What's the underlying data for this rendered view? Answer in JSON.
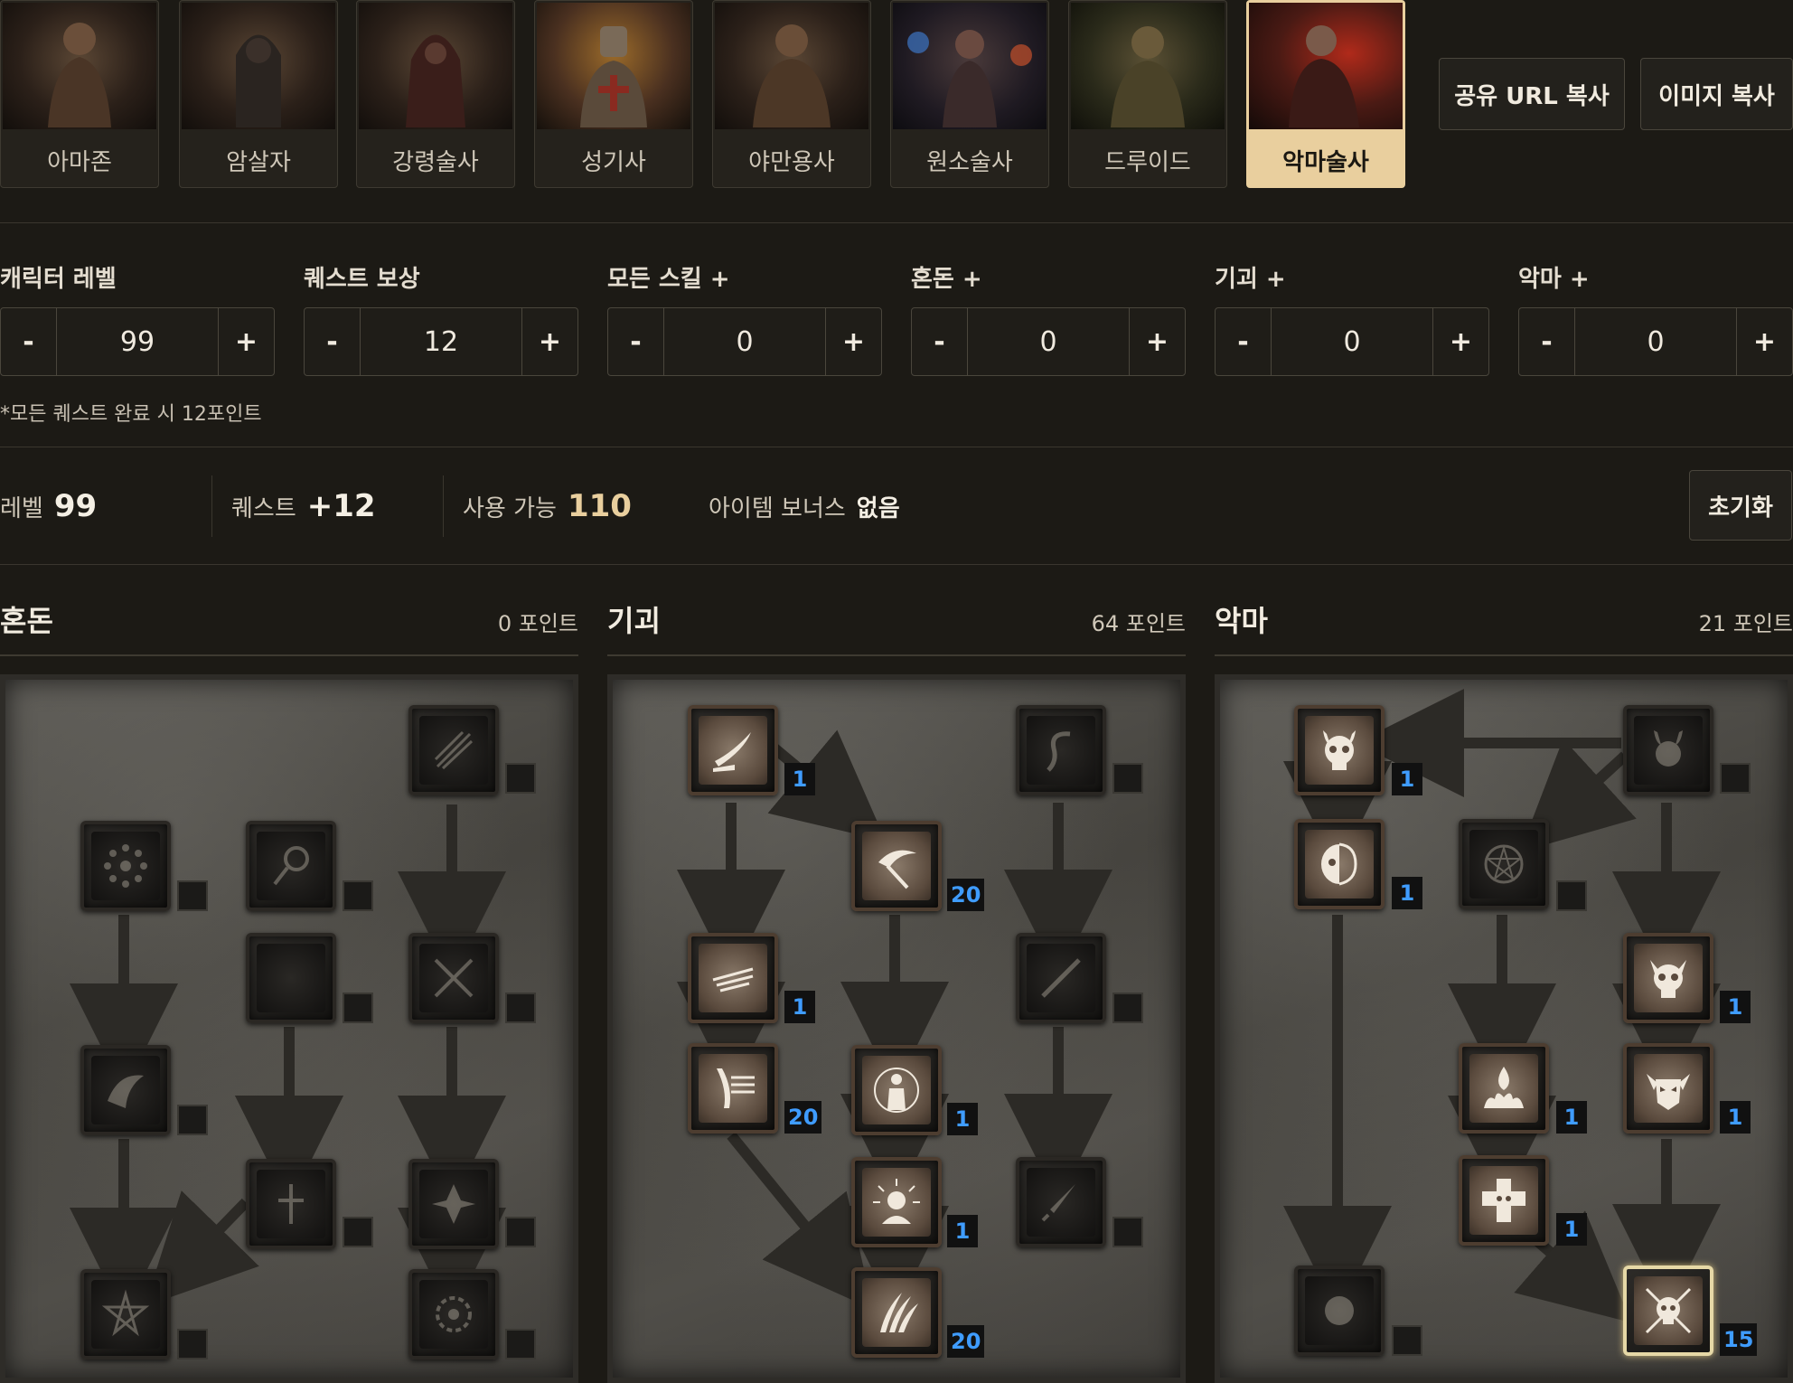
{
  "classes": [
    {
      "id": "amazon",
      "label": "아마존",
      "active": false
    },
    {
      "id": "assassin",
      "label": "암살자",
      "active": false
    },
    {
      "id": "necromancer",
      "label": "강령술사",
      "active": false
    },
    {
      "id": "paladin",
      "label": "성기사",
      "active": false
    },
    {
      "id": "barbarian",
      "label": "야만용사",
      "active": false
    },
    {
      "id": "sorceress",
      "label": "원소술사",
      "active": false
    },
    {
      "id": "druid",
      "label": "드루이드",
      "active": false
    },
    {
      "id": "warlock",
      "label": "악마술사",
      "active": true
    }
  ],
  "actions": {
    "share_url": "공유 URL 복사",
    "copy_image": "이미지 복사",
    "reset": "초기화"
  },
  "steppers": [
    {
      "label": "캐릭터 레벨",
      "value": "99"
    },
    {
      "label": "퀘스트 보상",
      "value": "12"
    },
    {
      "label": "모든 스킬 +",
      "value": "0"
    },
    {
      "label": "혼돈 +",
      "value": "0"
    },
    {
      "label": "기괴 +",
      "value": "0"
    },
    {
      "label": "악마 +",
      "value": "0"
    }
  ],
  "stepper_minus": "-",
  "stepper_plus": "+",
  "quest_note": "*모든 퀘스트 완료 시 12포인트",
  "summary": {
    "level_label": "레벨",
    "level_value": "99",
    "quest_label": "퀘스트",
    "quest_value": "+12",
    "available_label": "사용 가능",
    "available_value": "110",
    "item_bonus_label": "아이템 보너스",
    "item_bonus_value": "없음"
  },
  "trees": [
    {
      "name": "혼돈",
      "points": "0 포인트"
    },
    {
      "name": "기괴",
      "points": "64 포인트"
    },
    {
      "name": "악마",
      "points": "21 포인트"
    }
  ],
  "skill_levels": {
    "t2_s1": "1",
    "t2_s2": "20",
    "t2_s3": "1",
    "t2_s4": "20",
    "t2_s5": "1",
    "t2_s6": "1",
    "t2_s7": "20",
    "t3_s1": "1",
    "t3_s2": "1",
    "t3_s3": "1",
    "t3_s4": "1",
    "t3_s5": "1",
    "t3_s6": "1",
    "t3_s7": "15"
  },
  "colors": {
    "accent": "#e9cf9e",
    "level_blue": "#3f9cff",
    "background": "#1c1a15"
  }
}
